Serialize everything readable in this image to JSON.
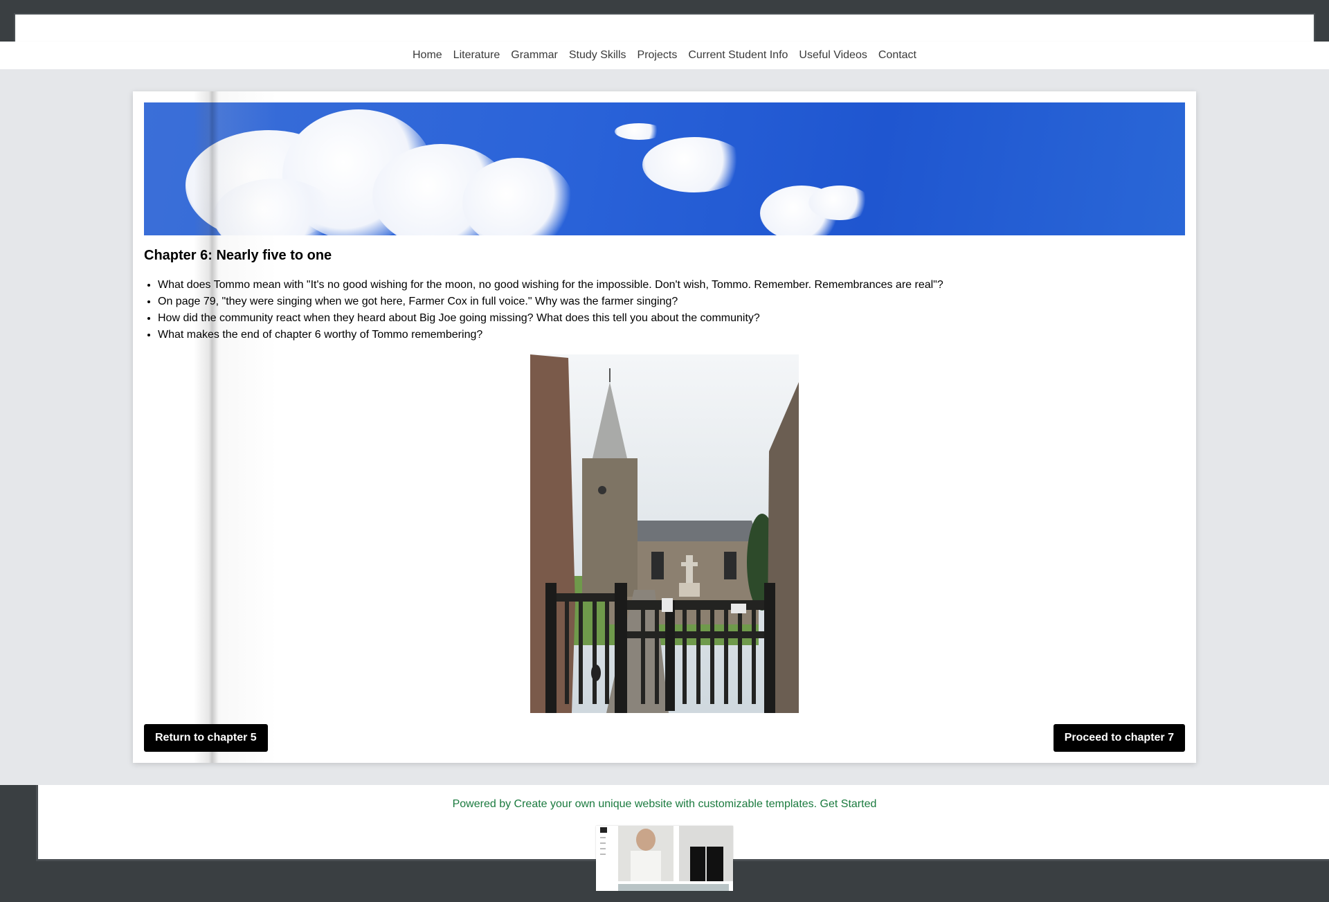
{
  "nav": {
    "items": [
      "Home",
      "Literature",
      "Grammar",
      "Study Skills",
      "Projects",
      "Current Student Info",
      "Useful Videos",
      "Contact"
    ]
  },
  "chapter": {
    "title": "Chapter 6: Nearly five to one",
    "questions": [
      "What does Tommo mean with \"It's no good wishing for the moon, no good wishing for the impossible. Don't wish, Tommo. Remember. Remembrances are real\"?",
      "On page 79, \"they were singing when we got here, Farmer Cox in full voice.\" Why was the farmer singing?",
      "How did the community react when they heard about Big Joe going missing? What does this tell you about the community?",
      "What makes the end of chapter 6 worthy of Tommo remembering?"
    ]
  },
  "buttons": {
    "prev": "Return to chapter 5",
    "next": "Proceed to chapter 7"
  },
  "footer": {
    "powered_text": "Powered by Create your own unique website with customizable templates. Get Started"
  },
  "colors": {
    "accent_footer_link": "#1a7a3e",
    "button_bg": "#000000",
    "sky_blue": "#2a63d9"
  }
}
